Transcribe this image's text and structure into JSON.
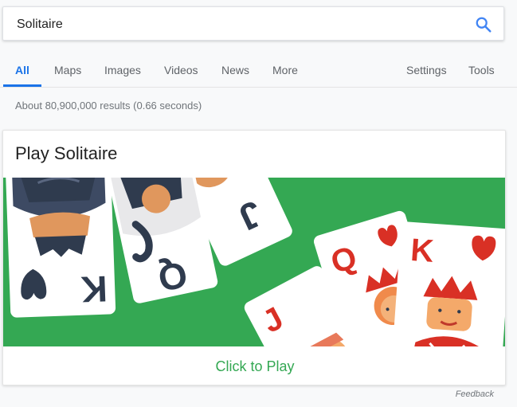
{
  "search": {
    "query": "Solitaire",
    "icon": "search-icon"
  },
  "nav": {
    "tabs": [
      {
        "label": "All",
        "active": true
      },
      {
        "label": "Maps"
      },
      {
        "label": "Images"
      },
      {
        "label": "Videos"
      },
      {
        "label": "News"
      },
      {
        "label": "More"
      }
    ],
    "right": [
      {
        "label": "Settings"
      },
      {
        "label": "Tools"
      }
    ]
  },
  "results": {
    "stats": "About 80,900,000 results (0.66 seconds)"
  },
  "card": {
    "title": "Play Solitaire",
    "cta": "Click to Play",
    "banner_color": "#34a853",
    "cards": {
      "k_dark": "K",
      "q_dark": "Q",
      "j_dark": "J",
      "j_red": "J",
      "q_red": "Q",
      "k_red": "K"
    }
  },
  "feedback": "Feedback",
  "colors": {
    "accent": "#1a73e8",
    "green": "#34a853",
    "red": "#d93025",
    "dark": "#2f3b4e"
  }
}
